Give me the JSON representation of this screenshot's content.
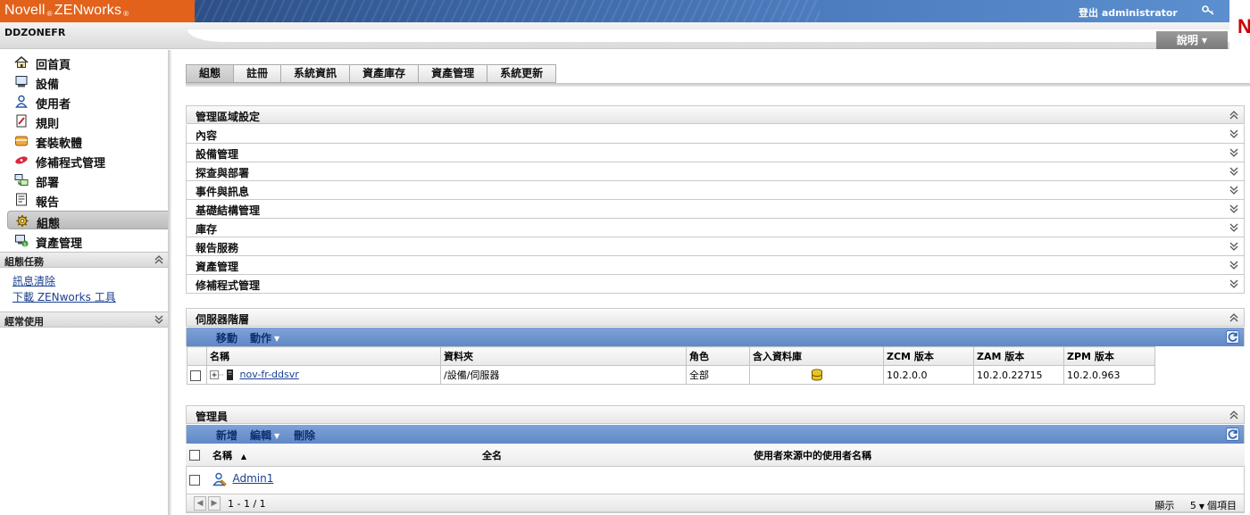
{
  "header": {
    "logo_brand": "Novell",
    "logo_product": "ZENworks",
    "logout_label": "登出 administrator",
    "zone_name": "DDZONEFR",
    "help_label": "說明",
    "corner_logo": "N"
  },
  "sidebar": {
    "items": [
      {
        "label": "回首頁",
        "icon": "home-icon"
      },
      {
        "label": "設備",
        "icon": "monitor-icon"
      },
      {
        "label": "使用者",
        "icon": "user-icon"
      },
      {
        "label": "規則",
        "icon": "policy-icon"
      },
      {
        "label": "套裝軟體",
        "icon": "bundle-icon"
      },
      {
        "label": "修補程式管理",
        "icon": "patch-icon"
      },
      {
        "label": "部署",
        "icon": "deploy-icon"
      },
      {
        "label": "報告",
        "icon": "report-icon"
      },
      {
        "label": "組態",
        "icon": "config-gear-icon",
        "active": true
      },
      {
        "label": "資產管理",
        "icon": "asset-icon"
      }
    ],
    "tasks_title": "組態任務",
    "task_links": [
      "訊息清除",
      "下載 ZENworks 工具"
    ],
    "frequent_title": "經常使用"
  },
  "tabs": [
    "組態",
    "註冊",
    "系統資訊",
    "資產庫存",
    "資產管理",
    "系統更新"
  ],
  "zone_settings": {
    "title": "管理區域設定",
    "rows": [
      "內容",
      "設備管理",
      "探查與部署",
      "事件與訊息",
      "基礎結構管理",
      "庫存",
      "報告服務",
      "資產管理",
      "修補程式管理"
    ]
  },
  "server_hierarchy": {
    "title": "伺服器階層",
    "actions": {
      "move": "移動",
      "action": "動作"
    },
    "columns": [
      "名稱",
      "資料夾",
      "角色",
      "含入資料庫",
      "ZCM 版本",
      "ZAM 版本",
      "ZPM 版本"
    ],
    "rows": [
      {
        "name": "nov-fr-ddsvr",
        "folder": "/設備/伺服器",
        "role": "全部",
        "zcm": "10.2.0.0",
        "zam": "10.2.0.22715",
        "zpm": "10.2.0.963"
      }
    ]
  },
  "administrators": {
    "title": "管理員",
    "actions": {
      "add": "新增",
      "edit": "編輯",
      "delete": "刪除"
    },
    "columns": {
      "name": "名稱",
      "sort": "▲",
      "fullname": "全名",
      "source_user": "使用者來源中的使用者名稱"
    },
    "rows": [
      {
        "name": "Admin1"
      }
    ],
    "pager": {
      "range": "1 - 1 / 1",
      "show_prefix": "顯示",
      "page_size": "5",
      "show_suffix": "個項目"
    }
  },
  "colors": {
    "brand_orange": "#e2621c",
    "banner_blue": "#3c66a6",
    "action_bar_blue": "#6b93cf",
    "link_blue": "#1a3f8f"
  }
}
